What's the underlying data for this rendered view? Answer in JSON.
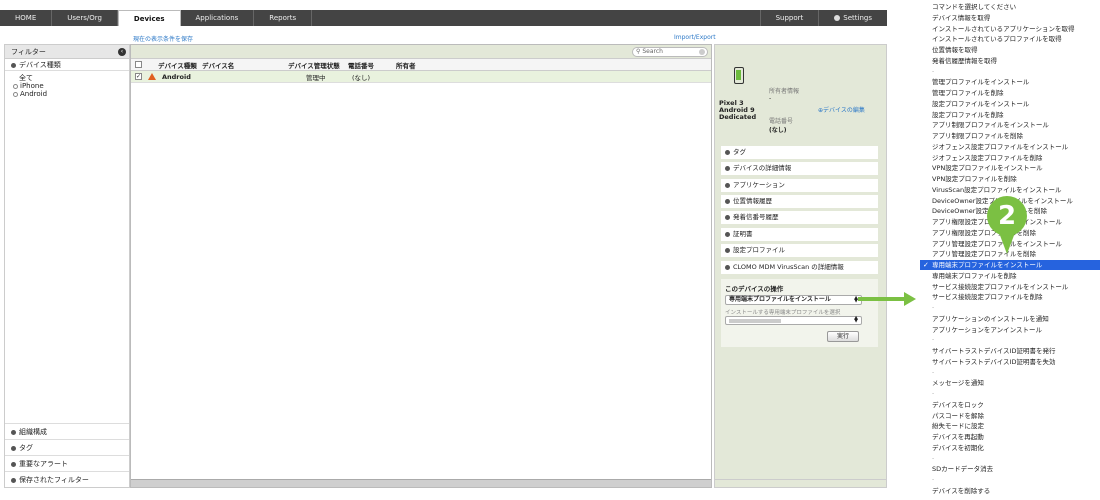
{
  "nav": {
    "tabs": [
      "HOME",
      "Users/Org",
      "Devices",
      "Applications",
      "Reports"
    ],
    "right": [
      "Support",
      "Settings"
    ]
  },
  "links": {
    "save_view": "現在の表示条件を保存",
    "import_export": "Import/Export"
  },
  "sidebar": {
    "header": "フィルター",
    "section": "デバイス種類",
    "tree": [
      "全て",
      "iPhone",
      "Android"
    ],
    "bottom": [
      "組織構成",
      "タグ",
      "重要なアラート",
      "保存されたフィルター"
    ]
  },
  "search": {
    "placeholder": "Search"
  },
  "table": {
    "headers": [
      "デバイス種類",
      "デバイス名",
      "デバイス管理状態",
      "電話番号",
      "所有者"
    ],
    "rows": [
      {
        "type": "Android",
        "name": "",
        "status": "管理中",
        "phone": "(なし)",
        "owner": ""
      }
    ]
  },
  "detail": {
    "device_lines": [
      "Pixel 3",
      "Android 9",
      "Dedicated"
    ],
    "owner_label": "所有者情報",
    "owner_value": "-",
    "edit_link": "デバイスの編集",
    "phone_label": "電話番号",
    "phone_value": "(なし)",
    "accordions": [
      "タグ",
      "デバイスの詳細情報",
      "アプリケーション",
      "位置情報履歴",
      "発着信番号履歴",
      "証明書",
      "設定プロファイル",
      "CLOMO MDM VirusScan の詳細情報"
    ],
    "ops_title": "このデバイスの操作",
    "ops_selected": "専用端末プロファイルをインストール",
    "ops_sub": "インストールする専用端末プロファイルを選択",
    "exec": "実行"
  },
  "menu": {
    "items": [
      "コマンドを選択してください",
      "デバイス情報を取得",
      "インストールされているアプリケーションを取得",
      "インストールされているプロファイルを取得",
      "位置情報を取得",
      "発着信履歴情報を取得",
      "-",
      "管理プロファイルをインストール",
      "管理プロファイルを削除",
      "設定プロファイルをインストール",
      "設定プロファイルを削除",
      "アプリ制限プロファイルをインストール",
      "アプリ制限プロファイルを削除",
      "ジオフェンス設定プロファイルをインストール",
      "ジオフェンス設定プロファイルを削除",
      "VPN設定プロファイルをインストール",
      "VPN設定プロファイルを削除",
      "VirusScan設定プロファイルをインストール",
      "DeviceOwner設定プロファイルをインストール",
      "DeviceOwner設定プロファイルを削除",
      "アプリ権限設定プロファイルをインストール",
      "アプリ権限設定プロファイルを削除",
      "アプリ管理設定プロファイルをインストール",
      "アプリ管理設定プロファイルを削除",
      "専用端末プロファイルをインストール",
      "専用端末プロファイルを削除",
      "サービス接続設定プロファイルをインストール",
      "サービス接続設定プロファイルを削除",
      "-",
      "アプリケーションのインストールを通知",
      "アプリケーションをアンインストール",
      "-",
      "サイバートラストデバイスID証明書を発行",
      "サイバートラストデバイスID証明書を失効",
      "-",
      "メッセージを通知",
      "-",
      "デバイスをロック",
      "パスコードを解除",
      "紛失モードに設定",
      "デバイスを再起動",
      "デバイスを初期化",
      "-",
      "SDカードデータ消去",
      "-",
      "デバイスを削除する"
    ],
    "selected_index": 24
  },
  "callout": {
    "number": "2"
  },
  "colors": {
    "accent_green": "#7bc043",
    "selection_blue": "#2663de",
    "link_blue": "#2d79c7"
  }
}
